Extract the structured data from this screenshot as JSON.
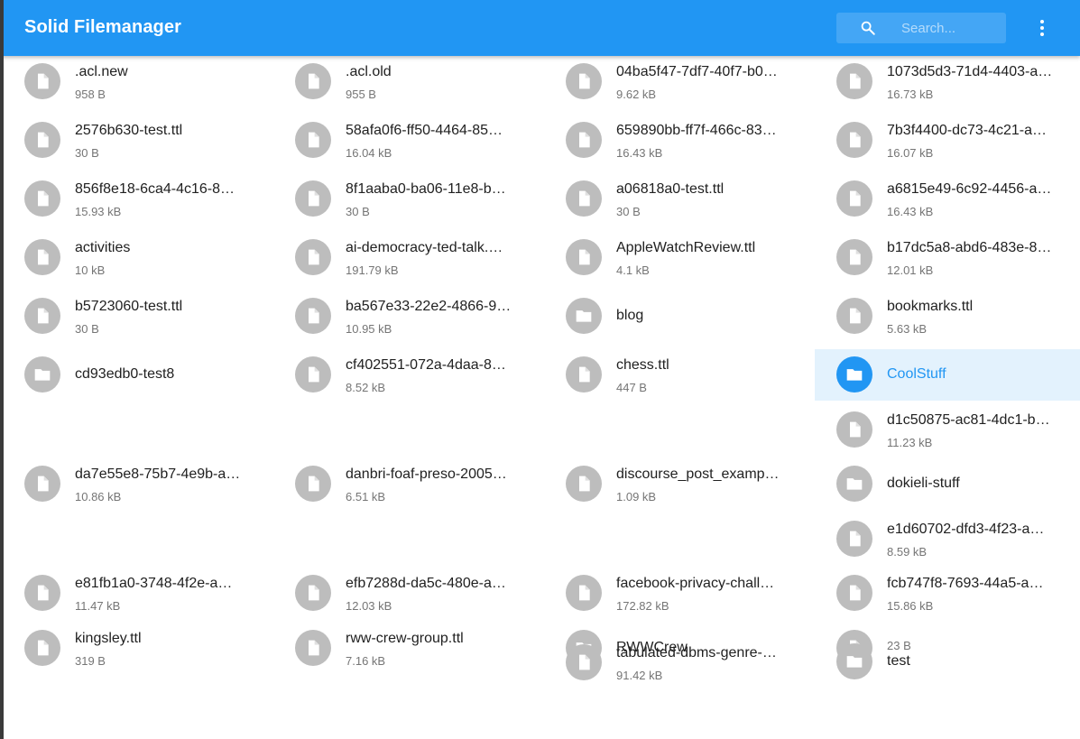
{
  "app": {
    "title": "Solid Filemanager",
    "search_placeholder": "Search...",
    "icons": {
      "search": "search-icon",
      "menu": "more-vert-icon",
      "file": "file-icon",
      "folder": "folder-icon"
    },
    "colors": {
      "primary": "#2196f3",
      "selected_bg": "#e3f2fd",
      "avatar_gray": "#bdbdbd"
    }
  },
  "items": [
    {
      "name": ".acl.new",
      "size": "958 B",
      "type": "file"
    },
    {
      "name": ".acl.old",
      "size": "955 B",
      "type": "file"
    },
    {
      "name": "04ba5f47-7df7-40f7-b0…",
      "size": "9.62 kB",
      "type": "file"
    },
    {
      "name": "1073d5d3-71d4-4403-a…",
      "size": "16.73 kB",
      "type": "file"
    },
    {
      "name": "2576b630-test.ttl",
      "size": "30 B",
      "type": "file"
    },
    {
      "name": "58afa0f6-ff50-4464-85…",
      "size": "16.04 kB",
      "type": "file"
    },
    {
      "name": "659890bb-ff7f-466c-83…",
      "size": "16.43 kB",
      "type": "file"
    },
    {
      "name": "7b3f4400-dc73-4c21-a…",
      "size": "16.07 kB",
      "type": "file"
    },
    {
      "name": "856f8e18-6ca4-4c16-8…",
      "size": "15.93 kB",
      "type": "file"
    },
    {
      "name": "8f1aaba0-ba06-11e8-b…",
      "size": "30 B",
      "type": "file"
    },
    {
      "name": "a06818a0-test.ttl",
      "size": "30 B",
      "type": "file"
    },
    {
      "name": "a6815e49-6c92-4456-a…",
      "size": "16.43 kB",
      "type": "file"
    },
    {
      "name": "activities",
      "size": "10 kB",
      "type": "file"
    },
    {
      "name": "ai-democracy-ted-talk.…",
      "size": "191.79 kB",
      "type": "file"
    },
    {
      "name": "AppleWatchReview.ttl",
      "size": "4.1 kB",
      "type": "file"
    },
    {
      "name": "b17dc5a8-abd6-483e-8…",
      "size": "12.01 kB",
      "type": "file"
    },
    {
      "name": "b5723060-test.ttl",
      "size": "30 B",
      "type": "file"
    },
    {
      "name": "ba567e33-22e2-4866-9…",
      "size": "10.95 kB",
      "type": "file"
    },
    {
      "name": "blog",
      "size": "",
      "type": "folder"
    },
    {
      "name": "bookmarks.ttl",
      "size": "5.63 kB",
      "type": "file"
    },
    {
      "name": "cd93edb0-test8",
      "size": "",
      "type": "folder"
    },
    {
      "name": "cf402551-072a-4daa-8…",
      "size": "8.52 kB",
      "type": "file"
    },
    {
      "name": "chess.ttl",
      "size": "447 B",
      "type": "file"
    },
    {
      "name": "CoolStuff",
      "size": "",
      "type": "folder",
      "selected": true
    },
    {
      "name": "d1c50875-ac81-4dc1-b…",
      "size": "11.23 kB",
      "type": "file"
    },
    {
      "name": "da7e55e8-75b7-4e9b-a…",
      "size": "10.86 kB",
      "type": "file"
    },
    {
      "name": "danbri-foaf-preso-2005…",
      "size": "6.51 kB",
      "type": "file"
    },
    {
      "name": "discourse_post_examp…",
      "size": "1.09 kB",
      "type": "file"
    },
    {
      "name": "dokieli-stuff",
      "size": "",
      "type": "folder"
    },
    {
      "name": "e1d60702-dfd3-4f23-a…",
      "size": "8.59 kB",
      "type": "file"
    },
    {
      "name": "e81fb1a0-3748-4f2e-a…",
      "size": "11.47 kB",
      "type": "file"
    },
    {
      "name": "efb7288d-da5c-480e-a…",
      "size": "12.03 kB",
      "type": "file"
    },
    {
      "name": "facebook-privacy-chall…",
      "size": "172.82 kB",
      "type": "file"
    },
    {
      "name": "fcb747f8-7693-44a5-a…",
      "size": "15.86 kB",
      "type": "file"
    },
    {
      "name": "kingsley.ttl",
      "size": "319 B",
      "type": "file"
    },
    {
      "name": "rww-crew-group.ttl",
      "size": "7.16 kB",
      "type": "file"
    },
    {
      "name": "RWWCrew",
      "size": "",
      "type": "folder"
    },
    {
      "name": "",
      "size": "23 B",
      "type": "file"
    },
    {
      "name": "tabulated-dbms-genre-…",
      "size": "91.42 kB",
      "type": "file"
    },
    {
      "name": "test",
      "size": "",
      "type": "folder"
    }
  ]
}
